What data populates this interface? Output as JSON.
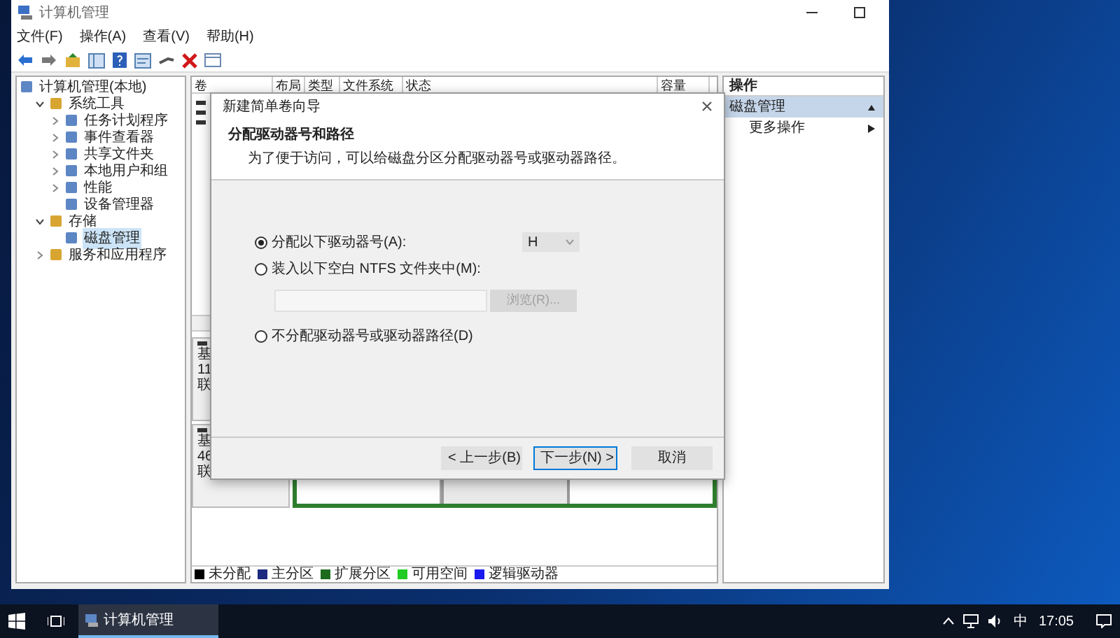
{
  "window": {
    "title": "计算机管理"
  },
  "menu": [
    "文件(F)",
    "操作(A)",
    "查看(V)",
    "帮助(H)"
  ],
  "tree": [
    {
      "label": "计算机管理(本地)",
      "selected": false,
      "children": [
        {
          "label": "系统工具",
          "selected": false,
          "expanded": true,
          "children": [
            {
              "label": "任务计划程序",
              "selected": false,
              "expanded": false
            },
            {
              "label": "事件查看器",
              "selected": false,
              "expanded": false
            },
            {
              "label": "共享文件夹",
              "selected": false,
              "expanded": false
            },
            {
              "label": "本地用户和组",
              "selected": false,
              "expanded": false
            },
            {
              "label": "性能",
              "selected": false,
              "expanded": false
            },
            {
              "label": "设备管理器",
              "selected": false
            }
          ]
        },
        {
          "label": "存储",
          "selected": false,
          "expanded": true,
          "children": [
            {
              "label": "磁盘管理",
              "selected": true
            }
          ]
        },
        {
          "label": "服务和应用程序",
          "selected": false,
          "expanded": false
        }
      ]
    }
  ],
  "volume_table": {
    "columns": [
      "卷",
      "布局",
      "类型",
      "文件系统",
      "状态",
      "容量"
    ]
  },
  "disks": [
    {
      "lines": [
        "基",
        "11",
        "联"
      ]
    },
    {
      "lines": [
        "基",
        "46",
        "联"
      ]
    }
  ],
  "legend": [
    {
      "label": "未分配",
      "color": "#000000"
    },
    {
      "label": "主分区",
      "color": "#1c2a80"
    },
    {
      "label": "扩展分区",
      "color": "#1e6b1e"
    },
    {
      "label": "可用空间",
      "color": "#22cc22"
    },
    {
      "label": "逻辑驱动器",
      "color": "#1a1aee"
    }
  ],
  "actions": {
    "header": "操作",
    "items": [
      {
        "label": "磁盘管理",
        "selected": true,
        "kind": "section"
      },
      {
        "label": "更多操作",
        "selected": false,
        "kind": "submenu"
      }
    ]
  },
  "dialog": {
    "title": "新建简单卷向导",
    "heading": "分配驱动器号和路径",
    "description": "为了便于访问，可以给磁盘分区分配驱动器号或驱动器路径。",
    "options": [
      {
        "label": "分配以下驱动器号(A):",
        "selected": true,
        "kind": "letter"
      },
      {
        "label": "装入以下空白 NTFS 文件夹中(M):",
        "selected": false,
        "kind": "folder"
      },
      {
        "label": "不分配驱动器号或驱动器路径(D)",
        "selected": false,
        "kind": "none"
      }
    ],
    "drive_letter": "H",
    "browse_button": "浏览(R)...",
    "buttons": [
      {
        "label": "< 上一步(B)",
        "focused": false
      },
      {
        "label": "下一步(N) >",
        "focused": true
      },
      {
        "label": "取消",
        "focused": false
      }
    ]
  },
  "taskbar": {
    "apps": [
      {
        "label": "计算机管理",
        "selected": true
      }
    ],
    "ime": "中",
    "time": "17:05"
  }
}
